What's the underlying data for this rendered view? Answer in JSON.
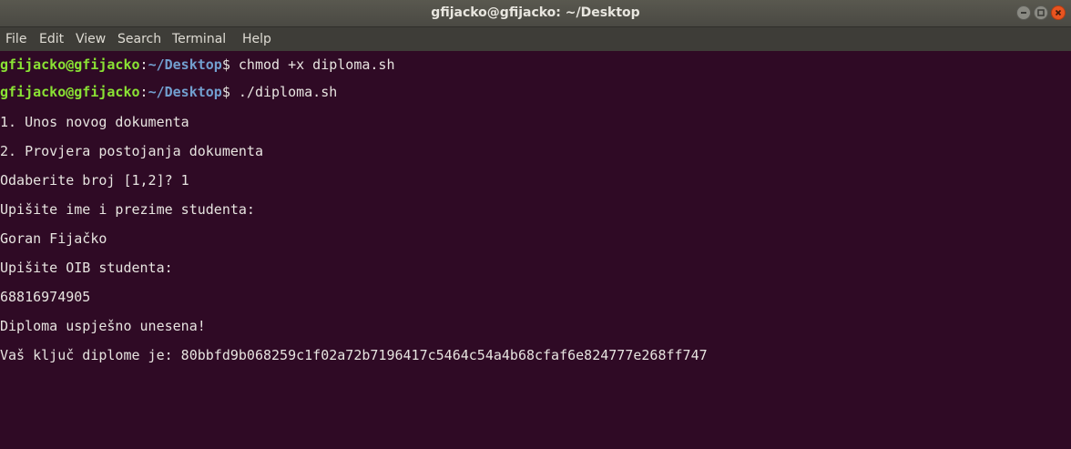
{
  "window": {
    "title": "gfijacko@gfijacko: ~/Desktop"
  },
  "menu": {
    "items": [
      "File",
      "Edit",
      "View",
      "Search",
      "Terminal",
      "Help"
    ]
  },
  "icons": {
    "minimize": "minimize-icon",
    "maximize": "maximize-icon",
    "close": "close-icon"
  },
  "colors": {
    "terminal_background": "#300a24",
    "prompt_user": "#8ae234",
    "prompt_path": "#729fcf",
    "text": "#e7e4e0",
    "close_button": "#e95420"
  },
  "terminal": {
    "prompt_user": "gfijacko@gfijacko",
    "prompt_separator": ":",
    "prompt_path": "~/Desktop",
    "prompt_symbol": "$",
    "commands": [
      " chmod +x diploma.sh",
      " ./diploma.sh"
    ],
    "output": [
      "1. Unos novog dokumenta",
      "2. Provjera postojanja dokumenta",
      "Odaberite broj [1,2]? 1",
      "Upišite ime i prezime studenta:",
      "Goran Fijačko",
      "Upišite OIB studenta:",
      "68816974905",
      "Diploma uspješno unesena!",
      "Vaš ključ diplome je: 80bbfd9b068259c1f02a72b7196417c5464c54a4b68cfaf6e824777e268ff747"
    ]
  }
}
